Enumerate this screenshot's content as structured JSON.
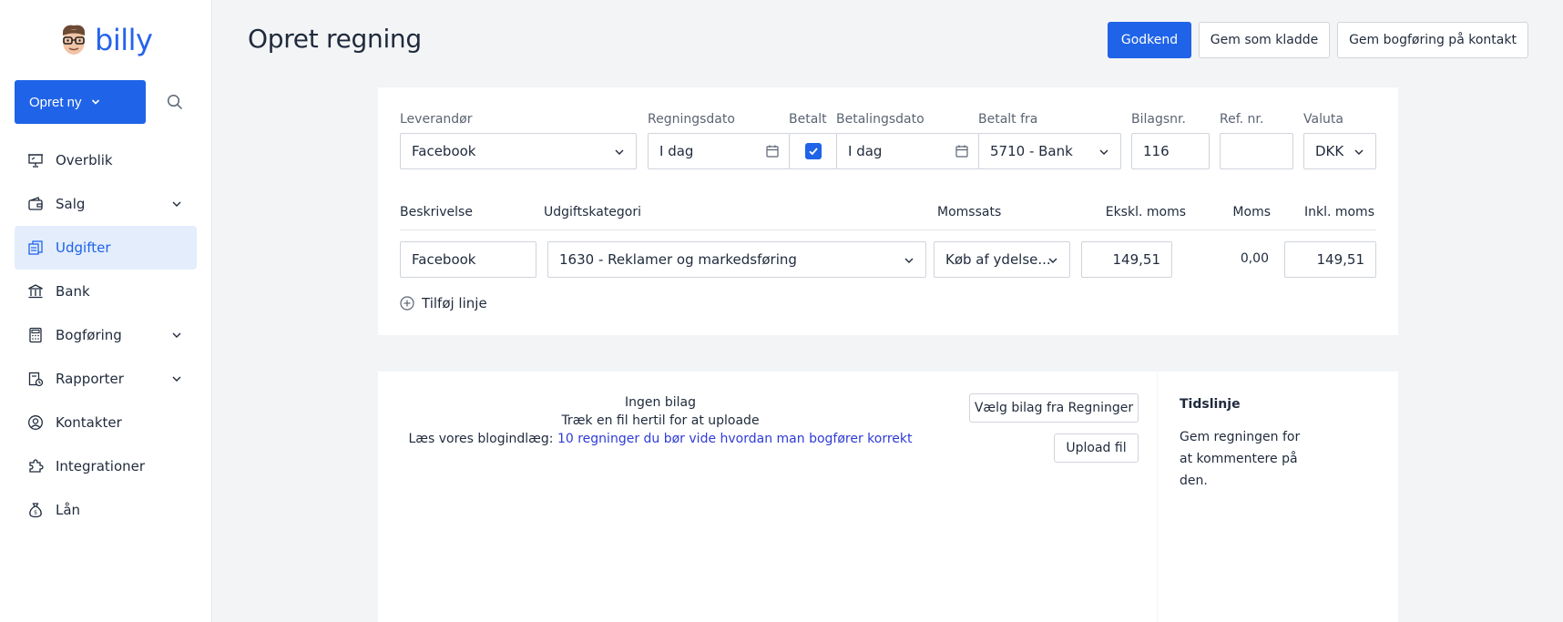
{
  "brand": {
    "name": "billy"
  },
  "sidebar": {
    "create_label": "Opret ny",
    "items": [
      {
        "label": "Overblik",
        "icon": "presentation-icon"
      },
      {
        "label": "Salg",
        "icon": "wallet-icon",
        "expandable": true
      },
      {
        "label": "Udgifter",
        "icon": "receipts-icon",
        "active": true
      },
      {
        "label": "Bank",
        "icon": "bank-icon"
      },
      {
        "label": "Bogføring",
        "icon": "calculator-icon",
        "expandable": true
      },
      {
        "label": "Rapporter",
        "icon": "report-icon",
        "expandable": true
      },
      {
        "label": "Kontakter",
        "icon": "user-circle-icon"
      },
      {
        "label": "Integrationer",
        "icon": "puzzle-icon"
      },
      {
        "label": "Lån",
        "icon": "money-bag-icon"
      }
    ]
  },
  "header": {
    "title": "Opret regning",
    "approve_label": "Godkend",
    "save_draft_label": "Gem som kladde",
    "save_contact_label": "Gem bogføring på kontakt"
  },
  "form": {
    "labels": {
      "supplier": "Leverandør",
      "bill_date": "Regningsdato",
      "paid": "Betalt",
      "payment_date": "Betalingsdato",
      "paid_from": "Betalt fra",
      "voucher_no": "Bilagsnr.",
      "ref_no": "Ref. nr.",
      "currency": "Valuta"
    },
    "values": {
      "supplier": "Facebook",
      "bill_date": "I dag",
      "paid": true,
      "payment_date": "I dag",
      "paid_from": "5710 - Bank",
      "voucher_no": "116",
      "ref_no": "",
      "currency": "DKK"
    },
    "line_headers": {
      "description": "Beskrivelse",
      "category": "Udgiftskategori",
      "vat_rate": "Momssats",
      "excl_vat": "Ekskl. moms",
      "vat": "Moms",
      "incl_vat": "Inkl. moms"
    },
    "line": {
      "description": "Facebook",
      "category": "1630 - Reklamer og markedsføring",
      "vat_rate": "Køb af ydelse...",
      "excl_vat": "149,51",
      "vat": "0,00",
      "incl_vat": "149,51"
    },
    "add_line_label": "Tilføj linje"
  },
  "attachments": {
    "empty_title": "Ingen bilag",
    "drag_hint": "Træk en fil hertil for at uploade",
    "blog_prefix": "Læs vores blogindlæg: ",
    "blog_link": "10 regninger du bør vide hvordan man bogfører korrekt",
    "choose_label": "Vælg bilag fra Regninger",
    "upload_label": "Upload fil"
  },
  "timeline": {
    "title": "Tidslinje",
    "text": "Gem regningen for at kommentere på den."
  },
  "colors": {
    "accent": "#1f63e8",
    "active_bg": "#e3edfc",
    "link": "#2f3bd6"
  }
}
